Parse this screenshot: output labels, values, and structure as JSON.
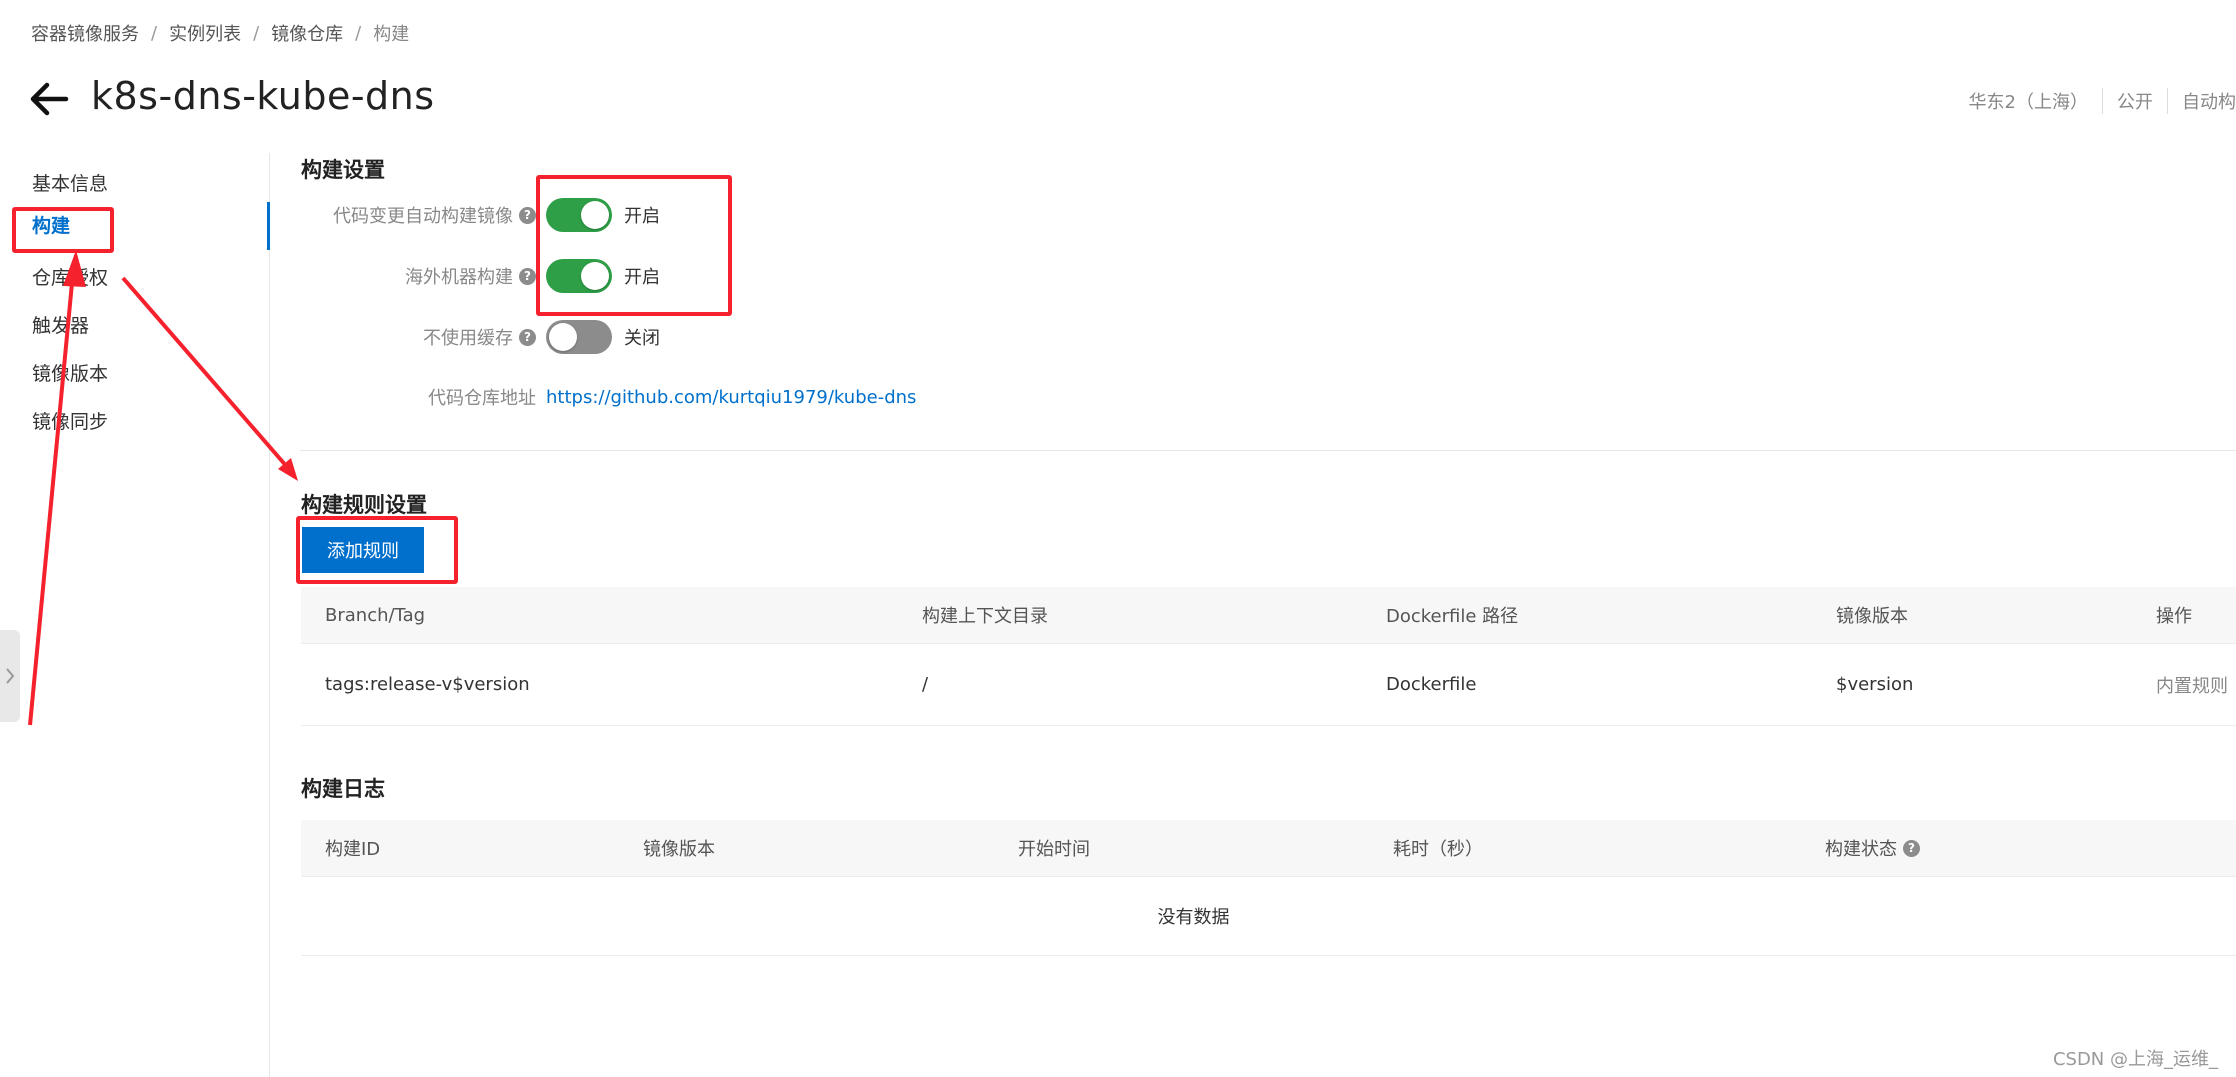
{
  "breadcrumb": {
    "items": [
      "容器镜像服务",
      "实例列表",
      "镜像仓库",
      "构建"
    ],
    "separator": "/"
  },
  "header": {
    "title": "k8s-dns-kube-dns",
    "meta": [
      "华东2（上海）",
      "公开",
      "自动构"
    ]
  },
  "sidebar": {
    "items": [
      "基本信息",
      "构建",
      "仓库授权",
      "触发器",
      "镜像版本",
      "镜像同步"
    ],
    "active_index": 1
  },
  "build_settings": {
    "title": "构建设置",
    "rows": [
      {
        "label": "代码变更自动构建镜像",
        "state": "开启",
        "on": true
      },
      {
        "label": "海外机器构建",
        "state": "开启",
        "on": true
      },
      {
        "label": "不使用缓存",
        "state": "关闭",
        "on": false
      }
    ],
    "repo_label": "代码仓库地址",
    "repo_url": "https://github.com/kurtqiu1979/kube-dns"
  },
  "build_rules": {
    "title": "构建规则设置",
    "add_button": "添加规则",
    "columns": [
      "Branch/Tag",
      "构建上下文目录",
      "Dockerfile 路径",
      "镜像版本",
      "操作"
    ],
    "rows": [
      {
        "branch_tag": "tags:release-v$version",
        "context": "/",
        "dockerfile": "Dockerfile",
        "version": "$version",
        "action": "内置规则"
      }
    ]
  },
  "build_log": {
    "title": "构建日志",
    "columns": [
      "构建ID",
      "镜像版本",
      "开始时间",
      "耗时（秒）",
      "构建状态"
    ],
    "empty_text": "没有数据"
  },
  "watermark": "CSDN @上海_运维_",
  "colors": {
    "accent": "#0070cc",
    "switch_on": "#2e9f47",
    "switch_off": "#8c8c8c",
    "annotation": "#f5222d"
  },
  "icons": {
    "back": "arrow-left-icon",
    "help": "question-circle-icon",
    "collapse": "chevron-right-icon"
  }
}
